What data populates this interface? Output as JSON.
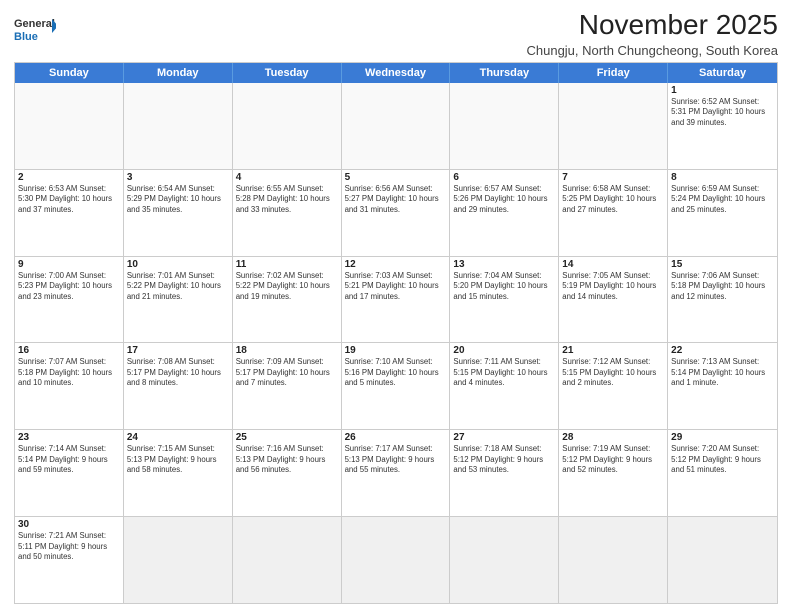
{
  "logo": {
    "text_general": "General",
    "text_blue": "Blue"
  },
  "title": "November 2025",
  "subtitle": "Chungju, North Chungcheong, South Korea",
  "header_days": [
    "Sunday",
    "Monday",
    "Tuesday",
    "Wednesday",
    "Thursday",
    "Friday",
    "Saturday"
  ],
  "weeks": [
    {
      "cells": [
        {
          "day": "",
          "info": ""
        },
        {
          "day": "",
          "info": ""
        },
        {
          "day": "",
          "info": ""
        },
        {
          "day": "",
          "info": ""
        },
        {
          "day": "",
          "info": ""
        },
        {
          "day": "",
          "info": ""
        },
        {
          "day": "1",
          "info": "Sunrise: 6:52 AM\nSunset: 5:31 PM\nDaylight: 10 hours\nand 39 minutes."
        }
      ]
    },
    {
      "cells": [
        {
          "day": "2",
          "info": "Sunrise: 6:53 AM\nSunset: 5:30 PM\nDaylight: 10 hours\nand 37 minutes."
        },
        {
          "day": "3",
          "info": "Sunrise: 6:54 AM\nSunset: 5:29 PM\nDaylight: 10 hours\nand 35 minutes."
        },
        {
          "day": "4",
          "info": "Sunrise: 6:55 AM\nSunset: 5:28 PM\nDaylight: 10 hours\nand 33 minutes."
        },
        {
          "day": "5",
          "info": "Sunrise: 6:56 AM\nSunset: 5:27 PM\nDaylight: 10 hours\nand 31 minutes."
        },
        {
          "day": "6",
          "info": "Sunrise: 6:57 AM\nSunset: 5:26 PM\nDaylight: 10 hours\nand 29 minutes."
        },
        {
          "day": "7",
          "info": "Sunrise: 6:58 AM\nSunset: 5:25 PM\nDaylight: 10 hours\nand 27 minutes."
        },
        {
          "day": "8",
          "info": "Sunrise: 6:59 AM\nSunset: 5:24 PM\nDaylight: 10 hours\nand 25 minutes."
        }
      ]
    },
    {
      "cells": [
        {
          "day": "9",
          "info": "Sunrise: 7:00 AM\nSunset: 5:23 PM\nDaylight: 10 hours\nand 23 minutes."
        },
        {
          "day": "10",
          "info": "Sunrise: 7:01 AM\nSunset: 5:22 PM\nDaylight: 10 hours\nand 21 minutes."
        },
        {
          "day": "11",
          "info": "Sunrise: 7:02 AM\nSunset: 5:22 PM\nDaylight: 10 hours\nand 19 minutes."
        },
        {
          "day": "12",
          "info": "Sunrise: 7:03 AM\nSunset: 5:21 PM\nDaylight: 10 hours\nand 17 minutes."
        },
        {
          "day": "13",
          "info": "Sunrise: 7:04 AM\nSunset: 5:20 PM\nDaylight: 10 hours\nand 15 minutes."
        },
        {
          "day": "14",
          "info": "Sunrise: 7:05 AM\nSunset: 5:19 PM\nDaylight: 10 hours\nand 14 minutes."
        },
        {
          "day": "15",
          "info": "Sunrise: 7:06 AM\nSunset: 5:18 PM\nDaylight: 10 hours\nand 12 minutes."
        }
      ]
    },
    {
      "cells": [
        {
          "day": "16",
          "info": "Sunrise: 7:07 AM\nSunset: 5:18 PM\nDaylight: 10 hours\nand 10 minutes."
        },
        {
          "day": "17",
          "info": "Sunrise: 7:08 AM\nSunset: 5:17 PM\nDaylight: 10 hours\nand 8 minutes."
        },
        {
          "day": "18",
          "info": "Sunrise: 7:09 AM\nSunset: 5:17 PM\nDaylight: 10 hours\nand 7 minutes."
        },
        {
          "day": "19",
          "info": "Sunrise: 7:10 AM\nSunset: 5:16 PM\nDaylight: 10 hours\nand 5 minutes."
        },
        {
          "day": "20",
          "info": "Sunrise: 7:11 AM\nSunset: 5:15 PM\nDaylight: 10 hours\nand 4 minutes."
        },
        {
          "day": "21",
          "info": "Sunrise: 7:12 AM\nSunset: 5:15 PM\nDaylight: 10 hours\nand 2 minutes."
        },
        {
          "day": "22",
          "info": "Sunrise: 7:13 AM\nSunset: 5:14 PM\nDaylight: 10 hours\nand 1 minute."
        }
      ]
    },
    {
      "cells": [
        {
          "day": "23",
          "info": "Sunrise: 7:14 AM\nSunset: 5:14 PM\nDaylight: 9 hours\nand 59 minutes."
        },
        {
          "day": "24",
          "info": "Sunrise: 7:15 AM\nSunset: 5:13 PM\nDaylight: 9 hours\nand 58 minutes."
        },
        {
          "day": "25",
          "info": "Sunrise: 7:16 AM\nSunset: 5:13 PM\nDaylight: 9 hours\nand 56 minutes."
        },
        {
          "day": "26",
          "info": "Sunrise: 7:17 AM\nSunset: 5:13 PM\nDaylight: 9 hours\nand 55 minutes."
        },
        {
          "day": "27",
          "info": "Sunrise: 7:18 AM\nSunset: 5:12 PM\nDaylight: 9 hours\nand 53 minutes."
        },
        {
          "day": "28",
          "info": "Sunrise: 7:19 AM\nSunset: 5:12 PM\nDaylight: 9 hours\nand 52 minutes."
        },
        {
          "day": "29",
          "info": "Sunrise: 7:20 AM\nSunset: 5:12 PM\nDaylight: 9 hours\nand 51 minutes."
        }
      ]
    },
    {
      "cells": [
        {
          "day": "30",
          "info": "Sunrise: 7:21 AM\nSunset: 5:11 PM\nDaylight: 9 hours\nand 50 minutes."
        },
        {
          "day": "",
          "info": ""
        },
        {
          "day": "",
          "info": ""
        },
        {
          "day": "",
          "info": ""
        },
        {
          "day": "",
          "info": ""
        },
        {
          "day": "",
          "info": ""
        },
        {
          "day": "",
          "info": ""
        }
      ]
    }
  ]
}
